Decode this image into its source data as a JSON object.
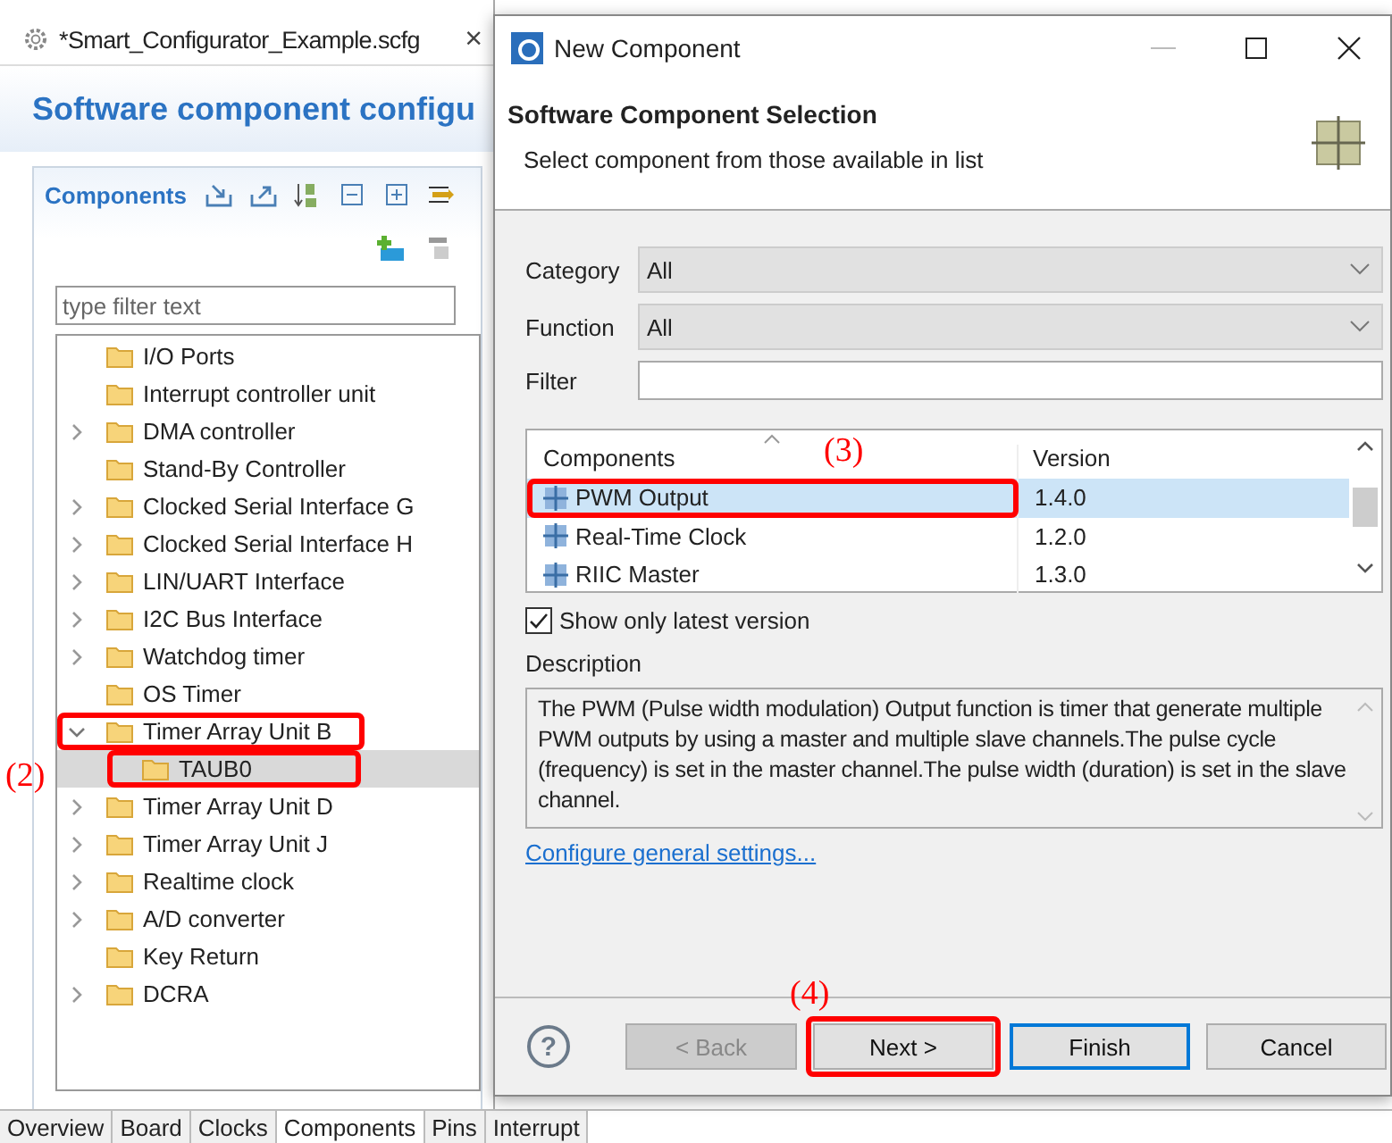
{
  "editor": {
    "tab": {
      "title": "*Smart_Configurator_Example.scfg",
      "close": "×"
    },
    "heading": "Software component configu",
    "components_panel": {
      "title": "Components",
      "filter": {
        "placeholder": "type filter text"
      },
      "tree": [
        {
          "label": "I/O Ports",
          "kind": "leaf",
          "selected": false
        },
        {
          "label": "Interrupt controller unit",
          "kind": "leaf",
          "selected": false
        },
        {
          "label": "DMA controller",
          "kind": "group",
          "expanded": false,
          "selected": false
        },
        {
          "label": "Stand-By Controller",
          "kind": "leaf",
          "selected": false
        },
        {
          "label": "Clocked Serial Interface G",
          "kind": "group",
          "expanded": false,
          "selected": false
        },
        {
          "label": "Clocked Serial Interface H",
          "kind": "group",
          "expanded": false,
          "selected": false
        },
        {
          "label": "LIN/UART Interface",
          "kind": "group",
          "expanded": false,
          "selected": false
        },
        {
          "label": "I2C Bus Interface",
          "kind": "group",
          "expanded": false,
          "selected": false
        },
        {
          "label": "Watchdog timer",
          "kind": "group",
          "expanded": false,
          "selected": false
        },
        {
          "label": "OS Timer",
          "kind": "leaf",
          "selected": false
        },
        {
          "label": "Timer Array Unit B",
          "kind": "group",
          "expanded": true,
          "selected": false,
          "children": [
            {
              "label": "TAUB0",
              "kind": "leaf",
              "selected": true
            }
          ]
        },
        {
          "label": "Timer Array Unit D",
          "kind": "group",
          "expanded": false,
          "selected": false
        },
        {
          "label": "Timer Array Unit J",
          "kind": "group",
          "expanded": false,
          "selected": false
        },
        {
          "label": "Realtime clock",
          "kind": "group",
          "expanded": false,
          "selected": false
        },
        {
          "label": "A/D converter",
          "kind": "group",
          "expanded": false,
          "selected": false
        },
        {
          "label": "Key Return",
          "kind": "leaf",
          "selected": false
        },
        {
          "label": "DCRA",
          "kind": "group",
          "expanded": false,
          "selected": false
        }
      ]
    },
    "bottom_tabs": [
      {
        "label": "Overview",
        "selected": false
      },
      {
        "label": "Board",
        "selected": false
      },
      {
        "label": "Clocks",
        "selected": false
      },
      {
        "label": "Components",
        "selected": true
      },
      {
        "label": "Pins",
        "selected": false
      },
      {
        "label": "Interrupt",
        "selected": false
      }
    ]
  },
  "dialog": {
    "title": "New Component",
    "header": {
      "title": "Software Component Selection",
      "subtitle": "Select component from those available in list"
    },
    "fields": [
      {
        "label": "Category",
        "kind": "combo",
        "value": "All"
      },
      {
        "label": "Function",
        "kind": "combo",
        "value": "All"
      },
      {
        "label": "Filter",
        "kind": "text"
      }
    ],
    "table": {
      "columns": [
        "Components",
        "Version"
      ],
      "rows": [
        {
          "name": "PWM Output",
          "version": "1.4.0",
          "selected": true
        },
        {
          "name": "Real-Time Clock",
          "version": "1.2.0",
          "selected": false
        },
        {
          "name": "RIIC Master",
          "version": "1.3.0",
          "selected": false
        }
      ]
    },
    "latest_only": {
      "label": "Show only latest version",
      "checked": true
    },
    "description": {
      "label": "Description",
      "text": "The PWM (Pulse width modulation) Output function is timer that generate multiple PWM outputs by using a master and multiple slave channels.The pulse cycle (frequency) is set in the master channel.The pulse width (duration) is set in the slave channel."
    },
    "link": "Configure general settings...",
    "help": "?",
    "buttons": [
      {
        "label": "< Back",
        "disabled": true,
        "default": false
      },
      {
        "label": "Next >",
        "disabled": false,
        "default": false
      },
      {
        "label": "Finish",
        "disabled": false,
        "default": true
      },
      {
        "label": "Cancel",
        "disabled": false,
        "default": false
      }
    ]
  },
  "annotations": [
    {
      "label": "(2)"
    },
    {
      "label": "(3)"
    },
    {
      "label": "(4)"
    }
  ]
}
